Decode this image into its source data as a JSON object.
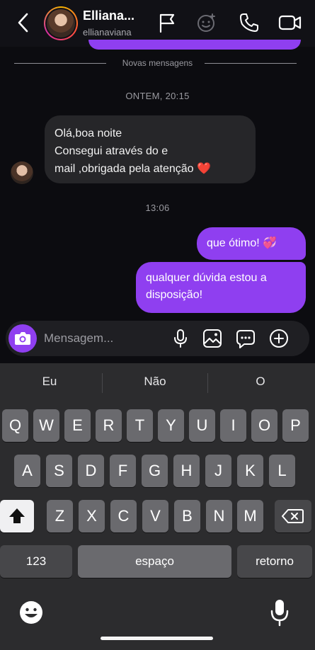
{
  "header": {
    "contact_name": "Elliana...",
    "username": "ellianaviana",
    "icons": [
      "back-chevron-icon",
      "flag-icon",
      "sticker-icon",
      "phone-icon",
      "video-camera-icon"
    ]
  },
  "chat": {
    "new_messages_label": "Novas mensagens",
    "timestamp_1": "ONTEM, 20:15",
    "incoming_lines": [
      "Olá,boa noite",
      "Consegui através do e",
      "mail ,obrigada pela atenção ❤️"
    ],
    "timestamp_2": "13:06",
    "outgoing_1": "que ótimo! 💞",
    "outgoing_2_lines": [
      "qualquer dúvida estou a",
      "disposição!"
    ],
    "colors": {
      "accent": "#8f3ff0",
      "incoming_bubble": "#262629",
      "background": "#0c0c10"
    }
  },
  "composer": {
    "placeholder": "Mensagem...",
    "icons": [
      "camera-icon",
      "microphone-icon",
      "gallery-icon",
      "sticker-chat-icon",
      "add-circle-icon"
    ]
  },
  "keyboard": {
    "suggestions": [
      "Eu",
      "Não",
      "O"
    ],
    "row1": [
      "Q",
      "W",
      "E",
      "R",
      "T",
      "Y",
      "U",
      "I",
      "O",
      "P"
    ],
    "row2": [
      "A",
      "S",
      "D",
      "F",
      "G",
      "H",
      "J",
      "K",
      "L"
    ],
    "row3": [
      "Z",
      "X",
      "C",
      "V",
      "B",
      "N",
      "M"
    ],
    "numbers_label": "123",
    "space_label": "espaço",
    "return_label": "retorno",
    "icons": [
      "shift-icon",
      "backspace-icon",
      "emoji-icon",
      "dictation-microphone-icon"
    ]
  }
}
